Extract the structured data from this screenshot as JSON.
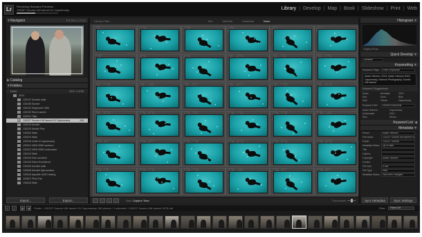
{
  "topbar": {
    "logo": "Lr",
    "status_title": "Rendering Standard Previews",
    "status_detail": "130307 Suunto UW launch 01 Caponmany",
    "progress": 0.45,
    "modules": [
      "Library",
      "Develop",
      "Map",
      "Book",
      "Slideshow",
      "Print",
      "Web"
    ],
    "active_module": "Library"
  },
  "navigator": {
    "title": "Navigator",
    "options": "FIT  FILL  1:1  3:1"
  },
  "catalog": {
    "title": "Catalog"
  },
  "folders": {
    "title": "Folders",
    "volume": {
      "name": "Node",
      "count": "523 / 1,5TB"
    },
    "items": [
      {
        "name": "2013",
        "count": "",
        "type": "year"
      },
      {
        "name": "130107 Kenalle walk",
        "count": ""
      },
      {
        "name": "130108 Sunset",
        "count": ""
      },
      {
        "name": "130122 Rayswoth 1989",
        "count": ""
      },
      {
        "name": "130130 Storm waves",
        "count": ""
      },
      {
        "name": "130201 Talip",
        "count": ""
      },
      {
        "name": "130207 Suunto UW launch 01 Caponmany",
        "count": "106",
        "selected": true
      },
      {
        "name": "130219 Kunath",
        "count": ""
      },
      {
        "name": "130220 Mobile Pics",
        "count": ""
      },
      {
        "name": "130303 Walk",
        "count": ""
      },
      {
        "name": "130310 Walk",
        "count": ""
      },
      {
        "name": "130316 Volde in Caponmany",
        "count": ""
      },
      {
        "name": "130321 NEW 0089 surfsecc",
        "count": ""
      },
      {
        "name": "130322 NEW 0089 underwater",
        "count": ""
      },
      {
        "name": "130413 Walk",
        "count": ""
      },
      {
        "name": "130418 Dive accident",
        "count": ""
      },
      {
        "name": "130419 Dives Excellence",
        "count": ""
      },
      {
        "name": "130425 Kenalle walk",
        "count": ""
      },
      {
        "name": "130508 Kenalle light surface",
        "count": ""
      },
      {
        "name": "130524 Aqualite dLED testing",
        "count": ""
      },
      {
        "name": "130527 Pixel Fair",
        "count": ""
      },
      {
        "name": "130618 Walk",
        "count": ""
      }
    ]
  },
  "left_buttons": {
    "import": "Import...",
    "export": "Export..."
  },
  "library_filter": {
    "title": "Library Filter :",
    "tabs": [
      "Text",
      "Attribute",
      "Metadata",
      "None"
    ],
    "active": "None"
  },
  "grid": {
    "rows": 6,
    "cols": 6,
    "first_number": 1
  },
  "toolbar": {
    "sort_label": "Sort:",
    "sort_value": "Capture Time",
    "thumbnails_label": "Thumbnails",
    "thumbnail_size": 0.6
  },
  "right_panel": {
    "histogram": "Histogram",
    "original_photo": "Original Photo",
    "quick_develop": {
      "title": "Quick Develop",
      "preset": "Defaults"
    },
    "keywording": {
      "title": "Keywording",
      "tags_label": "Keyword Tags",
      "tags_value": "Enter Keywords",
      "keywords": "Adam Harmon, 2013, Adam Harmon 2013, Caponmany, Harmon Photography, Suunto UW launch"
    },
    "keyword_suggestions": {
      "title": "Keyword Suggestions",
      "items": [
        "Ewan",
        "Mountain",
        "2013",
        "Sea",
        "Diver",
        "Blue",
        "Dive",
        "Ocean",
        "Caponmany"
      ]
    },
    "keyword_set": {
      "title": "Keyword Set",
      "value": "Recent Keywords",
      "items": [
        "Adam Harmon",
        "Caponmany",
        "Underwater",
        "2013",
        "Dive",
        "Divers"
      ]
    },
    "keyword_list": "Keyword List",
    "metadata": {
      "title": "Metadata",
      "preset_label": "Default",
      "preset_value": "Preset",
      "rows": [
        {
          "label": "Preset",
          "value": "Adam Harmon"
        },
        {
          "label": "File Name",
          "value": "130207 Suunto UW launch 0078.nef"
        },
        {
          "label": "Folder",
          "value": "130207 Suunto"
        },
        {
          "label": "Metadata Status",
          "value": "Up to date"
        },
        {
          "label": "Title",
          "value": ""
        },
        {
          "label": "Caption",
          "value": ""
        },
        {
          "label": "Copyright",
          "value": "Adam Harmon"
        },
        {
          "label": "Creator",
          "value": ""
        },
        {
          "label": "File Size",
          "value": "8 MB"
        },
        {
          "label": "File Type",
          "value": "Raw"
        },
        {
          "label": "Metadata Status",
          "value": "Has been changed"
        }
      ]
    },
    "sync_metadata": "Sync Metadata",
    "sync_settings": "Sync Settings"
  },
  "filmstrip_bar": {
    "page1": "1",
    "page2": "2",
    "path": "Folder : 130207 Suunto UW launch 01 Caponmany   106 photos / 1 selected / 130207 Suunto UW launch 0078.nef",
    "filter_label": "Filter :",
    "filter_value": "Filters Off"
  },
  "filmstrip": {
    "count": 26,
    "selected_index": 18
  }
}
